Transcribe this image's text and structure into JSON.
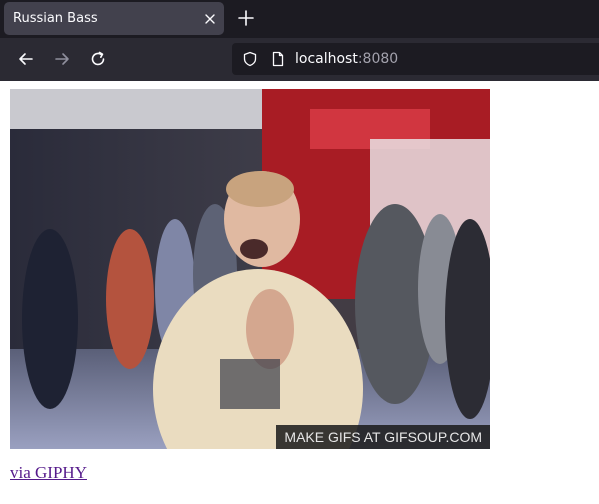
{
  "tab": {
    "title": "Russian Bass"
  },
  "urlbar": {
    "host": "localhost",
    "port": ":8080"
  },
  "page": {
    "watermark": "MAKE GIFS AT GIFSOUP.COM",
    "link_text": "via GIPHY"
  },
  "colors": {
    "chrome_bg": "#1c1b22",
    "tab_bg": "#42414d",
    "navbar_bg": "#2b2a33",
    "link_visited": "#551a8b"
  }
}
